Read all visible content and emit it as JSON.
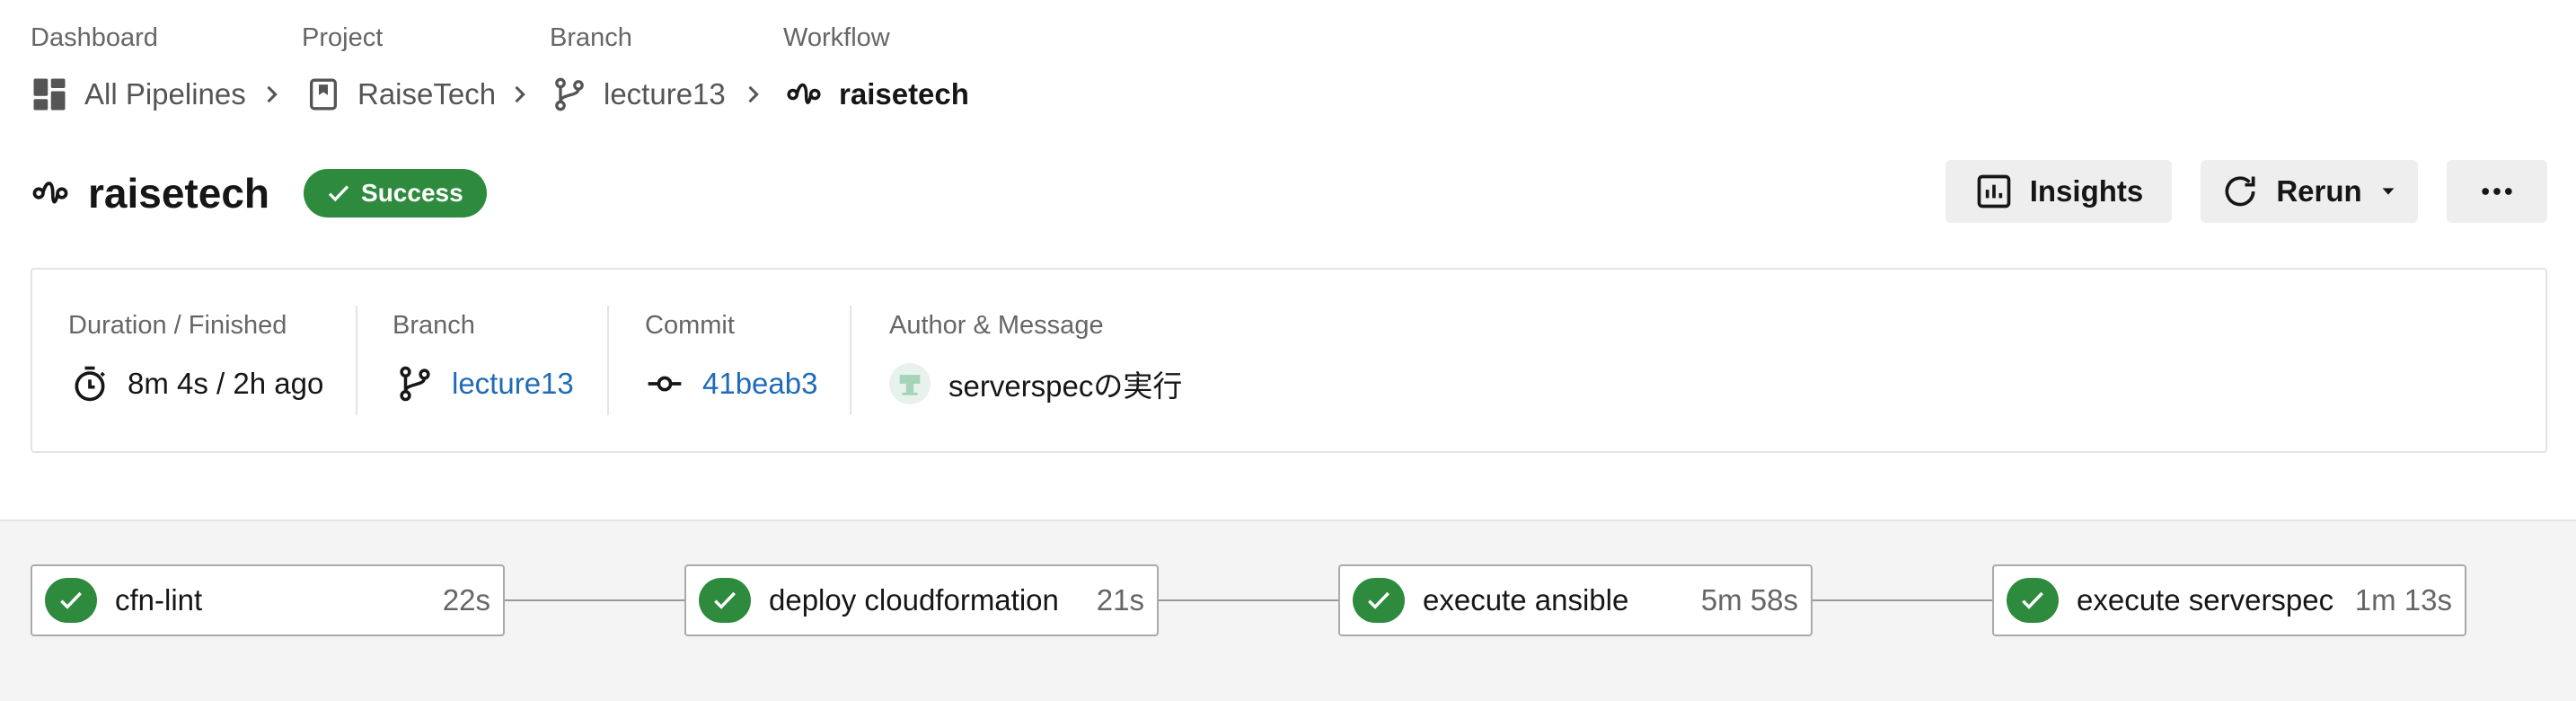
{
  "breadcrumb": {
    "dashboard": {
      "label": "Dashboard",
      "value": "All Pipelines"
    },
    "project": {
      "label": "Project",
      "value": "RaiseTech"
    },
    "branch": {
      "label": "Branch",
      "value": "lecture13"
    },
    "workflow": {
      "label": "Workflow",
      "value": "raisetech"
    }
  },
  "header": {
    "title": "raisetech",
    "status": "Success",
    "status_color": "#2e8b3e",
    "insights_label": "Insights",
    "rerun_label": "Rerun"
  },
  "summary": {
    "duration_label": "Duration / Finished",
    "duration_value": "8m 4s / 2h ago",
    "branch_label": "Branch",
    "branch_value": "lecture13",
    "commit_label": "Commit",
    "commit_value": "41beab3",
    "author_label": "Author & Message",
    "message": "serverspecの実行"
  },
  "jobs": [
    {
      "name": "cfn-lint",
      "duration": "22s"
    },
    {
      "name": "deploy cloudformation",
      "duration": "21s"
    },
    {
      "name": "execute ansible",
      "duration": "5m 58s"
    },
    {
      "name": "execute serverspec",
      "duration": "1m 13s"
    }
  ],
  "colors": {
    "success": "#2e8b3e",
    "link": "#1f6bb8",
    "graph_background": "#f4f4f4"
  }
}
